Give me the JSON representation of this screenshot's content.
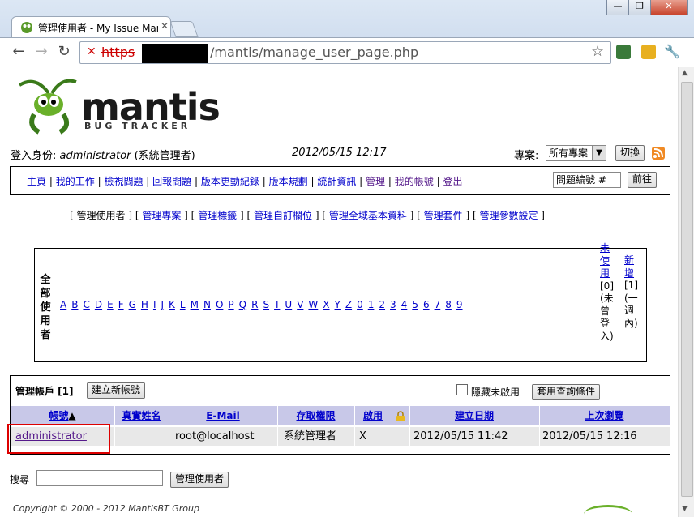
{
  "browser": {
    "tab_title": "管理使用者 - My Issue Mar",
    "url_scheme": "https",
    "url_path": "/mantis/manage_user_page.php",
    "window_buttons": [
      "—",
      "❐",
      "✕"
    ]
  },
  "header": {
    "logo_word": "mantis",
    "logo_sub": "BUG TRACKER",
    "login_label": "登入身份:",
    "login_user": "administrator",
    "login_role": "(系統管理者)",
    "datetime": "2012/05/15 12:17",
    "project_label": "專案:",
    "project_selected": "所有專案",
    "switch_button": "切換"
  },
  "menu": {
    "items": [
      "主頁",
      "我的工作",
      "檢視問題",
      "回報問題",
      "版本更動紀錄",
      "版本規劃",
      "統計資訊",
      "管理",
      "我的帳號",
      "登出"
    ],
    "issue_input_value": "問題編號 #",
    "go_button": "前往"
  },
  "manage_menu": {
    "current": "管理使用者",
    "links": [
      "管理專案",
      "管理標籤",
      "管理自訂欄位",
      "管理全域基本資料",
      "管理套件",
      "管理參數設定"
    ]
  },
  "filter": {
    "all_label": [
      "全",
      "部",
      "使",
      "用",
      "者"
    ],
    "letters": [
      "A",
      "B",
      "C",
      "D",
      "E",
      "F",
      "G",
      "H",
      "I",
      "J",
      "K",
      "L",
      "M",
      "N",
      "O",
      "P",
      "Q",
      "R",
      "S",
      "T",
      "U",
      "V",
      "W",
      "X",
      "Y",
      "Z",
      "0",
      "1",
      "2",
      "3",
      "4",
      "5",
      "6",
      "7",
      "8",
      "9"
    ],
    "unused_link": [
      "未",
      "使",
      "用"
    ],
    "unused_count": "[0]",
    "unused_note": [
      "(未",
      "曾",
      "登",
      "入)"
    ],
    "new_link": [
      "新",
      "增"
    ],
    "new_count": "[1]",
    "new_note": [
      "(一",
      "週",
      "內)"
    ]
  },
  "accounts": {
    "title": "管理帳戶 [1]",
    "create_button": "建立新帳號",
    "hide_disabled_label": "隱藏未啟用",
    "apply_filter_button": "套用查詢條件",
    "columns": [
      "帳號",
      "真實姓名",
      "E-Mail",
      "存取權限",
      "啟用",
      "",
      "建立日期",
      "上次瀏覽"
    ],
    "sort_arrow": "▲",
    "rows": [
      {
        "username": "administrator",
        "realname": "",
        "email": "root@localhost",
        "access": "系統管理者",
        "enabled": "X",
        "protected": "",
        "created": "2012/05/15 11:42",
        "last_visit": "2012/05/15 12:16"
      }
    ]
  },
  "search": {
    "label": "搜尋",
    "value": "",
    "button": "管理使用者"
  },
  "footer": {
    "copyright": "Copyright © 2000 - 2012 MantisBT Group"
  },
  "colors": {
    "header_row": "#c8c8e8",
    "data_row": "#e8e8e8",
    "link": "#0000cc",
    "highlight_box": "#dd0000"
  }
}
